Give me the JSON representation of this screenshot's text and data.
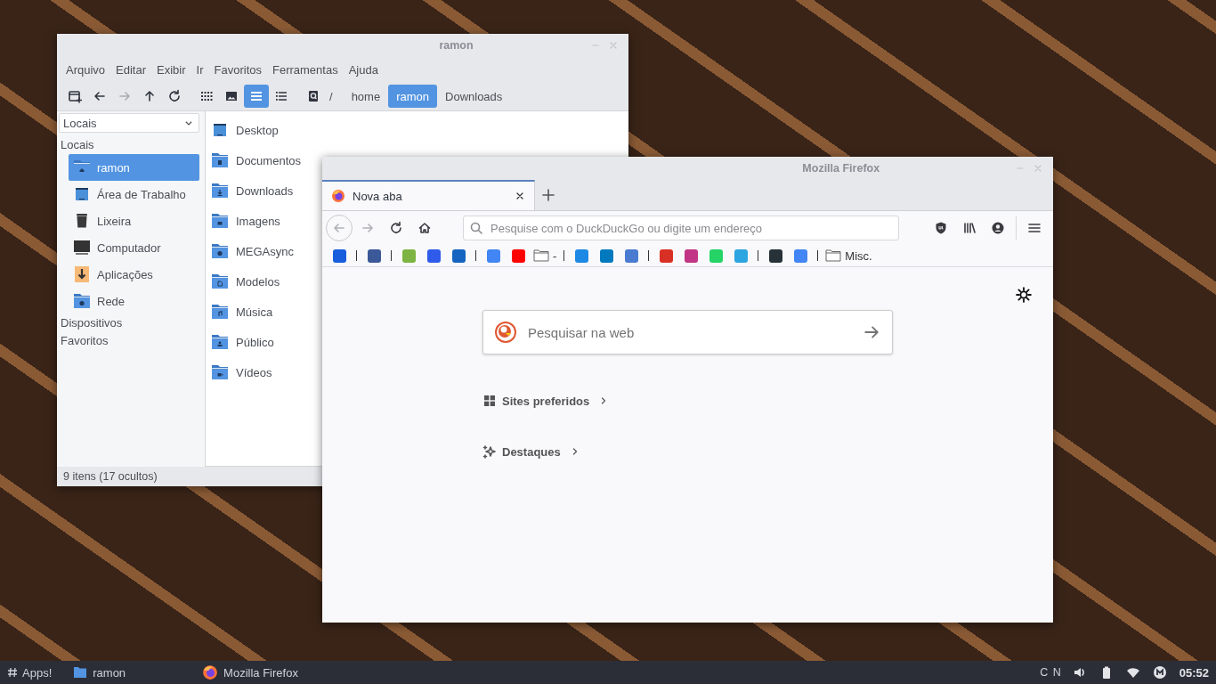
{
  "file_manager": {
    "title": "ramon",
    "menu": [
      "Arquivo",
      "Editar",
      "Exibir",
      "Ir",
      "Favoritos",
      "Ferramentas",
      "Ajuda"
    ],
    "nav_buttons": [
      {
        "kind": "new-window",
        "disabled": false
      },
      {
        "kind": "back",
        "disabled": false
      },
      {
        "kind": "forward",
        "disabled": true
      },
      {
        "kind": "up",
        "disabled": false
      },
      {
        "kind": "reload",
        "disabled": false
      }
    ],
    "view_buttons": [
      {
        "kind": "icons",
        "selected": false
      },
      {
        "kind": "thumbnails",
        "selected": false
      },
      {
        "kind": "list",
        "selected": true
      },
      {
        "kind": "details",
        "selected": false
      }
    ],
    "path_root": "/",
    "breadcrumbs": [
      {
        "label": "home",
        "selected": false
      },
      {
        "label": "ramon",
        "selected": true
      },
      {
        "label": "Downloads",
        "selected": false
      }
    ],
    "sidebar": {
      "dropdown": "Locais",
      "sections": [
        {
          "title": "Locais",
          "items": [
            {
              "label": "ramon",
              "kind": "home",
              "selected": true
            },
            {
              "label": "Área de Trabalho",
              "kind": "desktop",
              "selected": false
            },
            {
              "label": "Lixeira",
              "kind": "trash",
              "selected": false
            },
            {
              "label": "Computador",
              "kind": "computer",
              "selected": false
            },
            {
              "label": "Aplicações",
              "kind": "apps",
              "selected": false
            },
            {
              "label": "Rede",
              "kind": "network",
              "selected": false
            }
          ]
        },
        {
          "title": "Dispositivos"
        },
        {
          "title": "Favoritos"
        }
      ]
    },
    "files": [
      {
        "name": "Desktop",
        "kind": "desktop"
      },
      {
        "name": "Documentos",
        "kind": "document"
      },
      {
        "name": "Downloads",
        "kind": "download"
      },
      {
        "name": "Imagens",
        "kind": "image"
      },
      {
        "name": "MEGAsync",
        "kind": "mega"
      },
      {
        "name": "Modelos",
        "kind": "template"
      },
      {
        "name": "Música",
        "kind": "music"
      },
      {
        "name": "Público",
        "kind": "public"
      },
      {
        "name": "Vídeos",
        "kind": "video"
      }
    ],
    "status": "9 itens (17 ocultos)"
  },
  "firefox": {
    "title": "Mozilla Firefox",
    "tabs": [
      {
        "label": "Nova aba",
        "selected": true
      }
    ],
    "nav_buttons": [
      {
        "kind": "back",
        "disabled": true
      },
      {
        "kind": "forward",
        "disabled": true
      },
      {
        "kind": "reload",
        "disabled": false
      },
      {
        "kind": "home",
        "disabled": false
      }
    ],
    "url_placeholder": "Pesquise com o DuckDuckGo ou digite um endereço",
    "tools": [
      {
        "kind": "shield"
      },
      {
        "kind": "library"
      },
      {
        "kind": "account"
      }
    ],
    "bookmarks": [
      {
        "kind": "favicon",
        "color": "#175ddc"
      },
      {
        "kind": "separator"
      },
      {
        "kind": "favicon",
        "color": "#3b5998"
      },
      {
        "kind": "separator"
      },
      {
        "kind": "favicon",
        "color": "#7cb342"
      },
      {
        "kind": "favicon",
        "color": "#2f5bea"
      },
      {
        "kind": "favicon",
        "color": "#1565c0"
      },
      {
        "kind": "separator"
      },
      {
        "kind": "favicon",
        "color": "#4285f4"
      },
      {
        "kind": "favicon",
        "color": "#ff0000"
      },
      {
        "kind": "folder",
        "label": "-"
      },
      {
        "kind": "separator"
      },
      {
        "kind": "favicon",
        "color": "#1e88e5"
      },
      {
        "kind": "favicon",
        "color": "#0079bf"
      },
      {
        "kind": "favicon",
        "color": "#4a7bd0"
      },
      {
        "kind": "separator"
      },
      {
        "kind": "favicon",
        "color": "#d93025"
      },
      {
        "kind": "favicon",
        "color": "#c13584"
      },
      {
        "kind": "favicon",
        "color": "#25d366"
      },
      {
        "kind": "favicon",
        "color": "#2ca5e0"
      },
      {
        "kind": "separator"
      },
      {
        "kind": "favicon",
        "color": "#263238"
      },
      {
        "kind": "favicon",
        "color": "#4285f4"
      },
      {
        "kind": "separator"
      },
      {
        "kind": "folder",
        "label": "Misc."
      }
    ],
    "search_placeholder": "Pesquisar na web",
    "sections": [
      {
        "kind": "top-sites",
        "label": "Sites preferidos"
      },
      {
        "kind": "highlights",
        "label": "Destaques"
      }
    ]
  },
  "taskbar": {
    "apps_label": "Apps!",
    "tasks": [
      {
        "kind": "folder",
        "label": "ramon"
      },
      {
        "kind": "firefox",
        "label": "Mozilla Firefox"
      }
    ],
    "indicator": "C N",
    "tray": [
      {
        "kind": "volume"
      },
      {
        "kind": "battery"
      },
      {
        "kind": "wifi"
      },
      {
        "kind": "mega"
      }
    ],
    "clock": "05:52"
  }
}
